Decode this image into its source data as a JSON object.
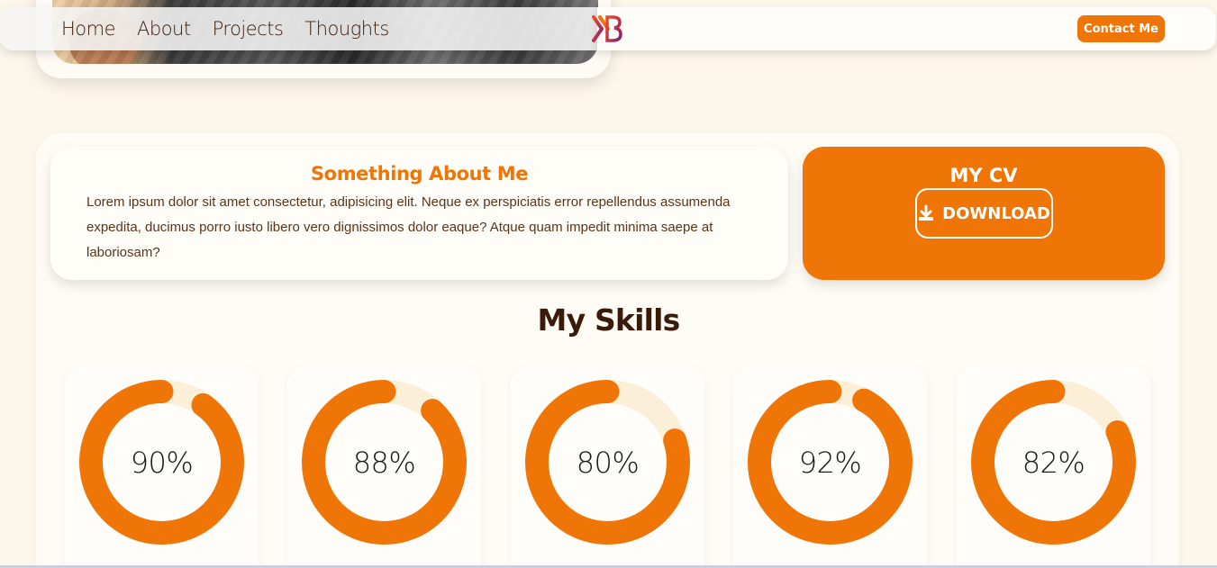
{
  "nav": {
    "links": [
      "Home",
      "About",
      "Projects",
      "Thoughts"
    ],
    "contact_label": "Contact Me"
  },
  "about": {
    "title": "Something About Me",
    "text": "Lorem ipsum dolor sit amet consectetur, adipisicing elit. Neque ex perspiciatis error repellendus assumenda expedita, ducimus porro iusto libero vero dignissimos dolor eaque? Atque quam impedit minima saepe at laboriosam?"
  },
  "cv": {
    "title": "MY CV",
    "download_label": "DOWNLOAD",
    "icon": "download-icon"
  },
  "skills": {
    "heading": "My Skills",
    "items": [
      {
        "label": "90%",
        "value": 90
      },
      {
        "label": "88%",
        "value": 88
      },
      {
        "label": "80%",
        "value": 80
      },
      {
        "label": "92%",
        "value": 92
      },
      {
        "label": "82%",
        "value": 82
      }
    ]
  },
  "colors": {
    "accent": "#f07507",
    "track": "#fcefd7",
    "background": "#fdf6ea",
    "text_dark": "#3a1a08"
  }
}
